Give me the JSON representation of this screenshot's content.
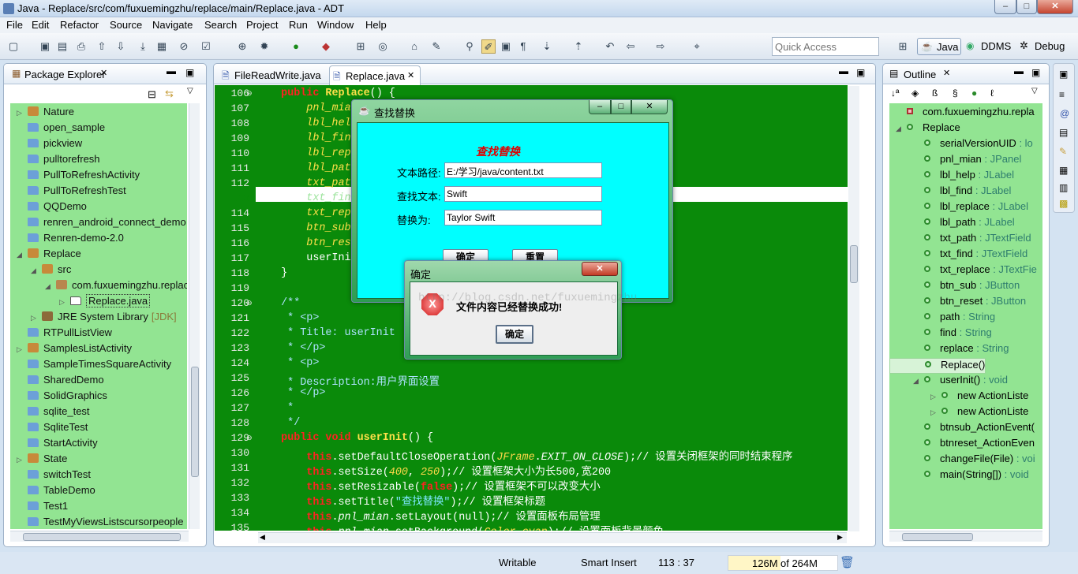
{
  "window": {
    "title": "Java - Replace/src/com/fuxuemingzhu/replace/main/Replace.java - ADT",
    "min": "–",
    "max": "□",
    "close": "✕"
  },
  "menu": [
    "File",
    "Edit",
    "Refactor",
    "Source",
    "Navigate",
    "Search",
    "Project",
    "Run",
    "Window",
    "Help"
  ],
  "quick_access": {
    "placeholder": "Quick Access"
  },
  "perspectives": [
    "Java",
    "DDMS",
    "Debug"
  ],
  "package_explorer": {
    "title": "Package Explorer",
    "items": [
      {
        "label": "Nature",
        "indent": 0,
        "arrow": "▷",
        "icon": "project"
      },
      {
        "label": "open_sample",
        "indent": 0,
        "arrow": "",
        "icon": "folder"
      },
      {
        "label": "pickview",
        "indent": 0,
        "arrow": "",
        "icon": "folder"
      },
      {
        "label": "pulltorefresh",
        "indent": 0,
        "arrow": "",
        "icon": "folder"
      },
      {
        "label": "PullToRefreshActivity",
        "indent": 0,
        "arrow": "",
        "icon": "folder"
      },
      {
        "label": "PullToRefreshTest",
        "indent": 0,
        "arrow": "",
        "icon": "folder"
      },
      {
        "label": "QQDemo",
        "indent": 0,
        "arrow": "",
        "icon": "folder"
      },
      {
        "label": "renren_android_connect_demo",
        "indent": 0,
        "arrow": "",
        "icon": "folder"
      },
      {
        "label": "Renren-demo-2.0",
        "indent": 0,
        "arrow": "",
        "icon": "folder"
      },
      {
        "label": "Replace",
        "indent": 0,
        "arrow": "◢",
        "icon": "project"
      },
      {
        "label": "src",
        "indent": 1,
        "arrow": "◢",
        "icon": "project"
      },
      {
        "label": "com.fuxuemingzhu.replac",
        "indent": 2,
        "arrow": "◢",
        "icon": "package"
      },
      {
        "label": "Replace.java",
        "indent": 3,
        "arrow": "▷",
        "icon": "file"
      },
      {
        "label": "JRE System Library",
        "indent": 1,
        "arrow": "▷",
        "icon": "lib",
        "extra": "[JDK]"
      },
      {
        "label": "RTPullListView",
        "indent": 0,
        "arrow": "",
        "icon": "folder"
      },
      {
        "label": "SamplesListActivity",
        "indent": 0,
        "arrow": "▷",
        "icon": "project"
      },
      {
        "label": "SampleTimesSquareActivity",
        "indent": 0,
        "arrow": "",
        "icon": "folder"
      },
      {
        "label": "SharedDemo",
        "indent": 0,
        "arrow": "",
        "icon": "folder"
      },
      {
        "label": "SolidGraphics",
        "indent": 0,
        "arrow": "",
        "icon": "folder"
      },
      {
        "label": "sqlite_test",
        "indent": 0,
        "arrow": "",
        "icon": "folder"
      },
      {
        "label": "SqliteTest",
        "indent": 0,
        "arrow": "",
        "icon": "folder"
      },
      {
        "label": "StartActivity",
        "indent": 0,
        "arrow": "",
        "icon": "folder"
      },
      {
        "label": "State",
        "indent": 0,
        "arrow": "▷",
        "icon": "project"
      },
      {
        "label": "switchTest",
        "indent": 0,
        "arrow": "",
        "icon": "folder"
      },
      {
        "label": "TableDemo",
        "indent": 0,
        "arrow": "",
        "icon": "folder"
      },
      {
        "label": "Test1",
        "indent": 0,
        "arrow": "",
        "icon": "folder"
      },
      {
        "label": "TestMyViewsListscursorpeople",
        "indent": 0,
        "arrow": "",
        "icon": "folder"
      }
    ]
  },
  "editor": {
    "tabs": [
      "FileReadWrite.java",
      "Replace.java"
    ],
    "line_numbers": [
      "106",
      "107",
      "108",
      "109",
      "110",
      "111",
      "112",
      "113",
      "114",
      "115",
      "116",
      "117",
      "118",
      "119",
      "120",
      "121",
      "122",
      "123",
      "124",
      "125",
      "126",
      "127",
      "128",
      "129",
      "130",
      "131",
      "132",
      "133",
      "134",
      "135"
    ],
    "lines": [
      "    public Replace() {",
      "        pnl_mian",
      "        lbl_hel",
      "        lbl_fin",
      "        lbl_rep",
      "        lbl_pat",
      "        txt_pat",
      "        txt_fin",
      "        txt_rep",
      "        btn_sub",
      "        btn_res",
      "        userIni",
      "    }",
      "",
      "    /**",
      "     * <p>",
      "     * Title: userInit",
      "     * </p>",
      "     * <p>",
      "     * Description:用户界面设置",
      "     * </p>",
      "     *",
      "     */",
      "    public void userInit() {",
      "        this.setDefaultCloseOperation(JFrame.EXIT_ON_CLOSE);// 设置关闭框架的同时结束程序",
      "        this.setSize(400, 250);// 设置框架大小为长500,宽200",
      "        this.setResizable(false);// 设置框架不可以改变大小",
      "        this.setTitle(\"查找替换\");// 设置框架标题",
      "        this.pnl_mian.setLayout(null);// 设置面板布局管理",
      "        this.pnl_mian.setBackground(Color.cyan);// 设置面板背景颜色"
    ]
  },
  "find_dialog": {
    "title": "查找替换",
    "heading": "查找替换",
    "path_label": "文本路径:",
    "path_value": "E:/学习/java/content.txt",
    "find_label": "查找文本:",
    "find_value": "Swift",
    "replace_label": "替换为:",
    "replace_value": "Taylor Swift",
    "ok": "确定",
    "reset": "重置"
  },
  "confirm_dialog": {
    "title": "确定",
    "message": "文件内容已经替换成功!",
    "ok": "确定",
    "close": "✕",
    "watermark": "http://blog.csdn.net/fuxuemingzhu"
  },
  "outline": {
    "title": "Outline",
    "items": [
      {
        "label": "com.fuxuemingzhu.repla",
        "type": "",
        "indent": 0,
        "arrow": ""
      },
      {
        "label": "Replace",
        "type": "",
        "indent": 0,
        "arrow": "◢"
      },
      {
        "label": "serialVersionUID",
        "type": " : lo",
        "indent": 1,
        "arrow": ""
      },
      {
        "label": "pnl_mian",
        "type": " : JPanel",
        "indent": 1,
        "arrow": ""
      },
      {
        "label": "lbl_help",
        "type": " : JLabel",
        "indent": 1,
        "arrow": ""
      },
      {
        "label": "lbl_find",
        "type": " : JLabel",
        "indent": 1,
        "arrow": ""
      },
      {
        "label": "lbl_replace",
        "type": " : JLabel",
        "indent": 1,
        "arrow": ""
      },
      {
        "label": "lbl_path",
        "type": " : JLabel",
        "indent": 1,
        "arrow": ""
      },
      {
        "label": "txt_path",
        "type": " : JTextField",
        "indent": 1,
        "arrow": ""
      },
      {
        "label": "txt_find",
        "type": " : JTextField",
        "indent": 1,
        "arrow": ""
      },
      {
        "label": "txt_replace",
        "type": " : JTextFie",
        "indent": 1,
        "arrow": ""
      },
      {
        "label": "btn_sub",
        "type": " : JButton",
        "indent": 1,
        "arrow": ""
      },
      {
        "label": "btn_reset",
        "type": " : JButton",
        "indent": 1,
        "arrow": ""
      },
      {
        "label": "path",
        "type": " : String",
        "indent": 1,
        "arrow": ""
      },
      {
        "label": "find",
        "type": " : String",
        "indent": 1,
        "arrow": ""
      },
      {
        "label": "replace",
        "type": " : String",
        "indent": 1,
        "arrow": ""
      },
      {
        "label": "Replace()",
        "type": "",
        "indent": 1,
        "arrow": ""
      },
      {
        "label": "userInit()",
        "type": " : void",
        "indent": 1,
        "arrow": "◢"
      },
      {
        "label": "new ActionListe",
        "type": "",
        "indent": 2,
        "arrow": "▷"
      },
      {
        "label": "new ActionListe",
        "type": "",
        "indent": 2,
        "arrow": "▷"
      },
      {
        "label": "btnsub_ActionEvent(",
        "type": "",
        "indent": 1,
        "arrow": ""
      },
      {
        "label": "btnreset_ActionEven",
        "type": "",
        "indent": 1,
        "arrow": ""
      },
      {
        "label": "changeFile(File)",
        "type": " : voi",
        "indent": 1,
        "arrow": ""
      },
      {
        "label": "main(String[])",
        "type": " : void",
        "indent": 1,
        "arrow": ""
      }
    ]
  },
  "status": {
    "writable": "Writable",
    "insert": "Smart Insert",
    "position": "113 : 37",
    "heap_used": "126M",
    "heap_of": "of 264M",
    "heap_fraction": 0.48
  },
  "colors": {
    "editor_bg": "#0a8a0a",
    "panel_green": "#92e492",
    "dialog_cyan": "#00ffff"
  }
}
